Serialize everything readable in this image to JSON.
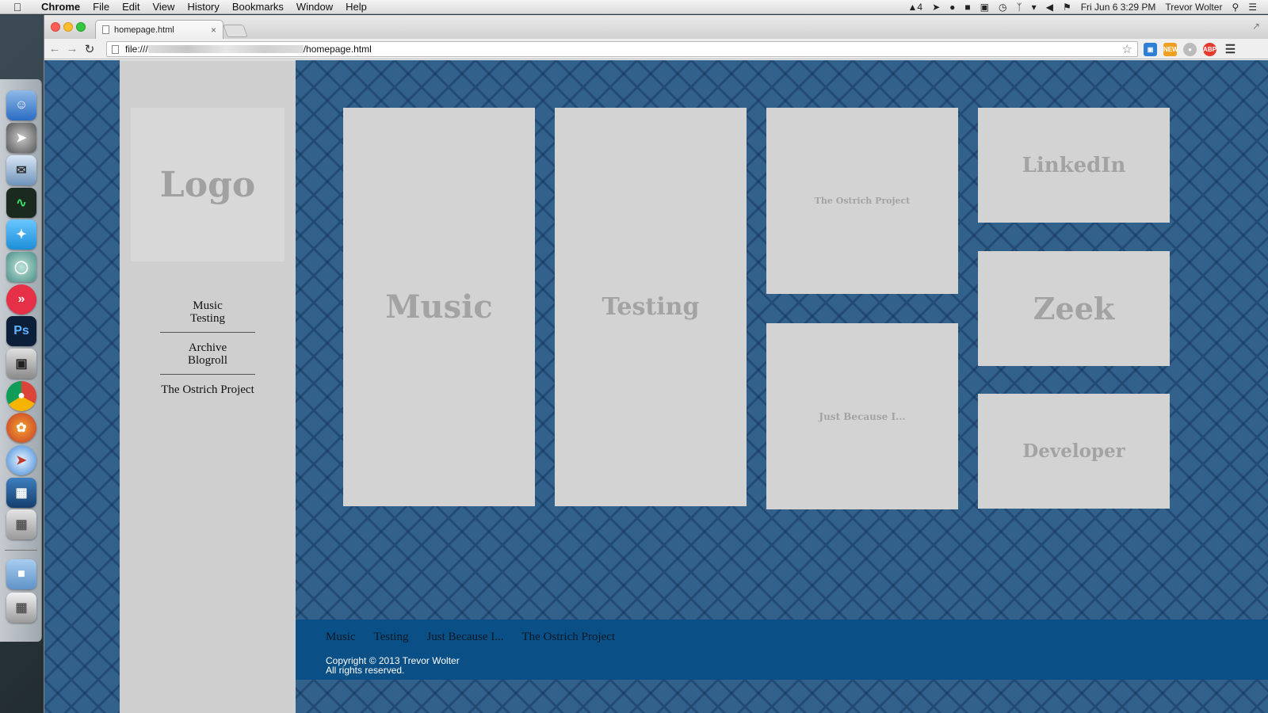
{
  "menubar": {
    "app": "Chrome",
    "items": [
      "File",
      "Edit",
      "View",
      "History",
      "Bookmarks",
      "Window",
      "Help"
    ],
    "status_count": "4",
    "datetime": "Fri Jun 6  3:29 PM",
    "user": "Trevor Wolter"
  },
  "browser": {
    "tab_title": "homepage.html",
    "url_prefix": "file:///",
    "url_suffix": "/homepage.html",
    "ext_new_badge": "NEW",
    "ext_abp_badge": "ABP"
  },
  "dock": {
    "apps": [
      "finder",
      "launchpad",
      "mail",
      "activity-monitor",
      "twitter",
      "messages",
      "direct",
      "photoshop",
      "image-capture",
      "chrome",
      "firefox",
      "safari",
      "virtualbox",
      "calculator",
      "folder",
      "trash"
    ],
    "ps_label": "Ps"
  },
  "page": {
    "logo": "Logo",
    "sidebar_nav": [
      [
        "Music",
        "Testing"
      ],
      [
        "Archive",
        "Blogroll"
      ],
      [
        "The Ostrich Project"
      ]
    ],
    "tiles": {
      "music": "Music",
      "testing": "Testing",
      "ostrich": "The Ostrich Project",
      "just_because": "Just Because I...",
      "linkedin": "LinkedIn",
      "zeek": "Zeek",
      "developer": "Developer"
    },
    "footer_nav": [
      "Music",
      "Testing",
      "Just Because I...",
      "The Ostrich Project"
    ],
    "copyright_line1": "Copyright © 2013 Trevor Wolter",
    "copyright_line2": "All rights reserved."
  }
}
